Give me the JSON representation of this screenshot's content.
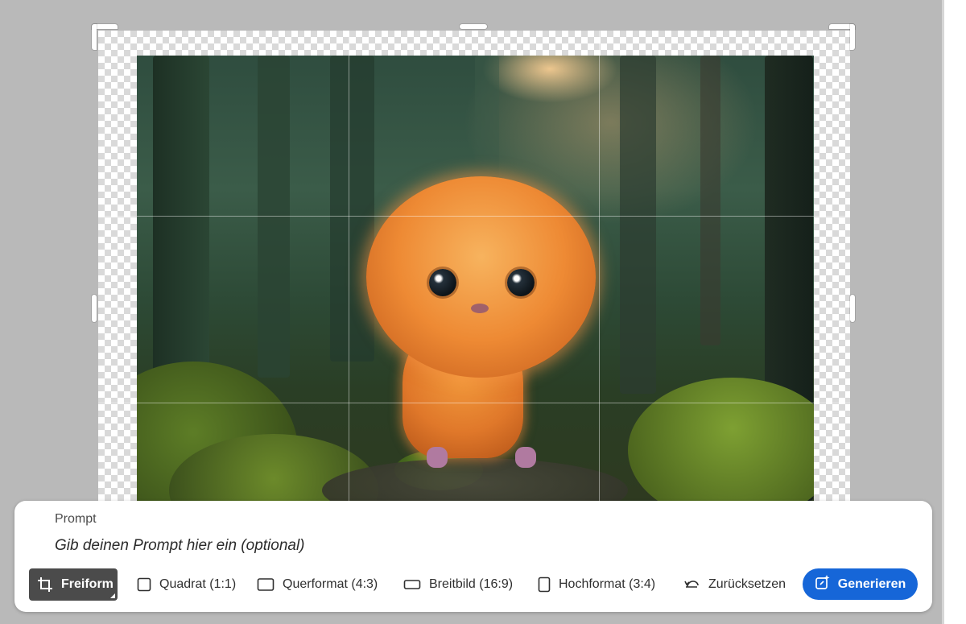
{
  "prompt": {
    "label": "Prompt",
    "placeholder": "Gib deinen Prompt hier ein (optional)"
  },
  "toolbar": {
    "aspect_options": [
      {
        "label": "Freiform",
        "icon": "crop-icon",
        "selected": true
      },
      {
        "label": "Quadrat (1:1)",
        "icon": "square-icon",
        "selected": false
      },
      {
        "label": "Querformat (4:3)",
        "icon": "landscape-icon",
        "selected": false
      },
      {
        "label": "Breitbild (16:9)",
        "icon": "widescreen-icon",
        "selected": false
      },
      {
        "label": "Hochformat (3:4)",
        "icon": "portrait-icon",
        "selected": false
      }
    ],
    "reset_label": "Zurücksetzen",
    "reset_icon": "undo-icon",
    "generate_label": "Generieren",
    "generate_icon": "generative-expand-icon"
  },
  "canvas": {
    "image": "orange-fluffy-creature-in-forest",
    "transparent_area": "checkerboard"
  },
  "colors": {
    "accent": "#1666d8",
    "selected_option_bg": "#4b4b4b",
    "workspace_bg": "#b9b9b9"
  }
}
